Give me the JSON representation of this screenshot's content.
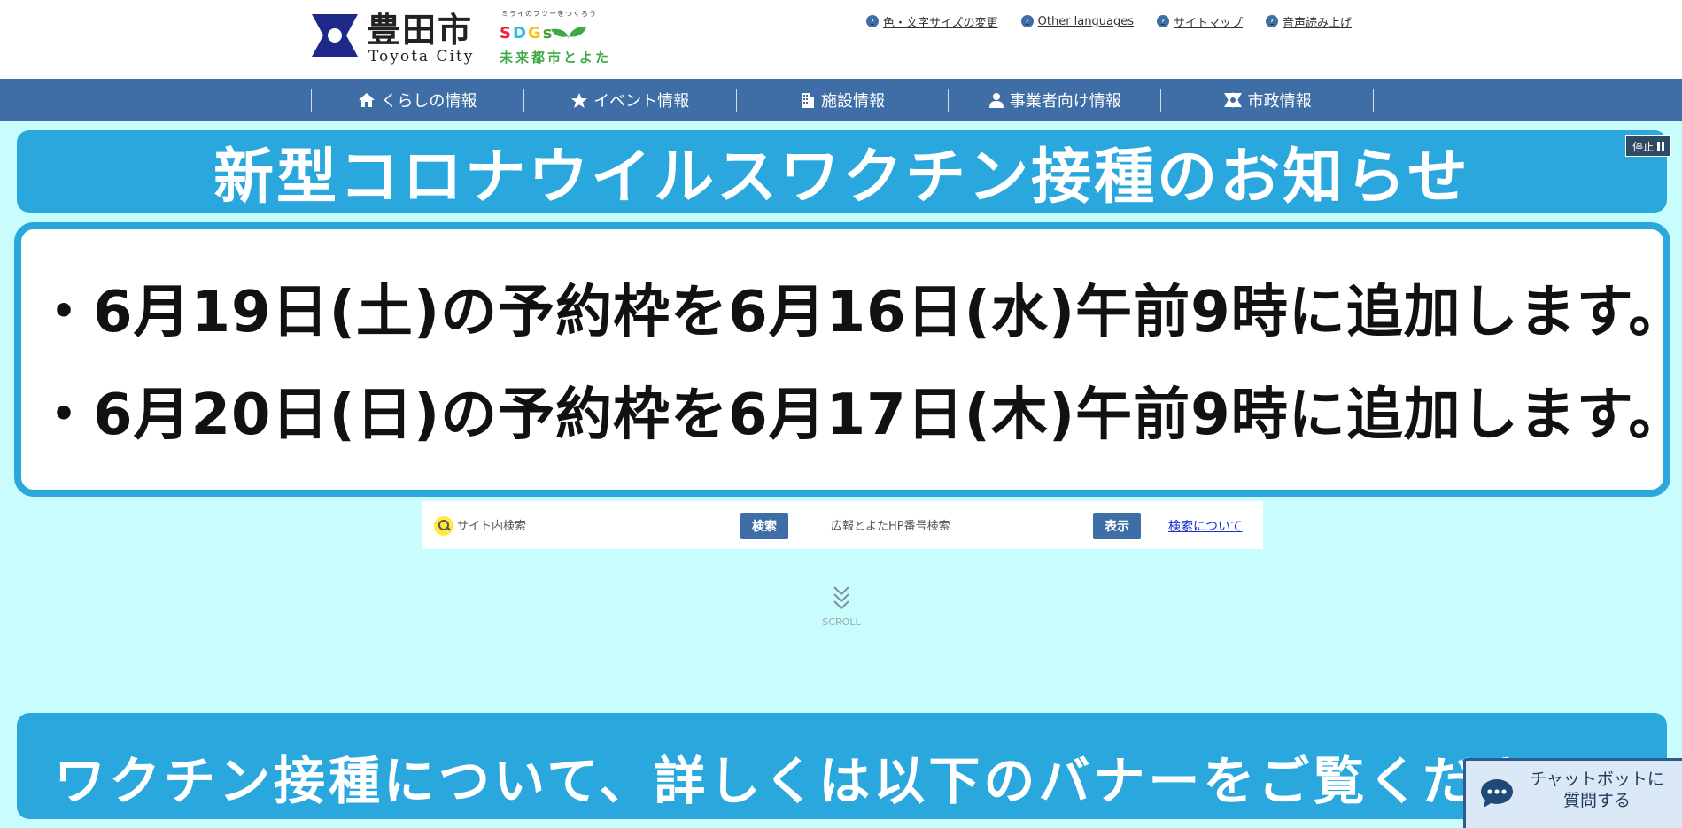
{
  "header": {
    "logo_jp": "豊田市",
    "logo_en": "Toyota City",
    "sdgs_tagline": "ミライのフツーをつくろう",
    "sdgs_word": [
      "S",
      "D",
      "G",
      "s"
    ],
    "sdgs_city": "未来都市とよた"
  },
  "utility_links": [
    {
      "label": "色・文字サイズの変更",
      "icon": "chevron-right-icon"
    },
    {
      "label": "Other languages",
      "icon": "chevron-right-icon"
    },
    {
      "label": "サイトマップ",
      "icon": "chevron-right-icon"
    },
    {
      "label": "音声読み上げ",
      "icon": "chevron-right-icon"
    }
  ],
  "nav": [
    {
      "label": "くらしの情報",
      "icon": "home-icon"
    },
    {
      "label": "イベント情報",
      "icon": "star-icon"
    },
    {
      "label": "施設情報",
      "icon": "building-icon"
    },
    {
      "label": "事業者向け情報",
      "icon": "person-icon"
    },
    {
      "label": "市政情報",
      "icon": "city-emblem-icon"
    }
  ],
  "banner": {
    "title": "新型コロナウイルスワクチン接種のお知らせ",
    "line1": "・6月19日(土)の予約枠を6月16日(水)午前9時に追加します。",
    "line2": "・6月20日(日)の予約枠を6月17日(木)午前9時に追加します。",
    "stop_label": "停止"
  },
  "search": {
    "site_placeholder": "サイト内検索",
    "site_button": "検索",
    "number_placeholder": "広報とよたHP番号検索",
    "number_button": "表示",
    "help_link": "検索について"
  },
  "scroll": {
    "label": "SCROLL"
  },
  "bottom_banner": {
    "text": "ワクチン接種について、詳しくは以下のバナーをご覧ください"
  },
  "chatbot": {
    "line1": "チャットボットに",
    "line2": "質問する"
  },
  "colors": {
    "nav_bg": "#3e6ea5",
    "banner_blue": "#2aa7dc",
    "page_bg": "#c9fdfd"
  }
}
